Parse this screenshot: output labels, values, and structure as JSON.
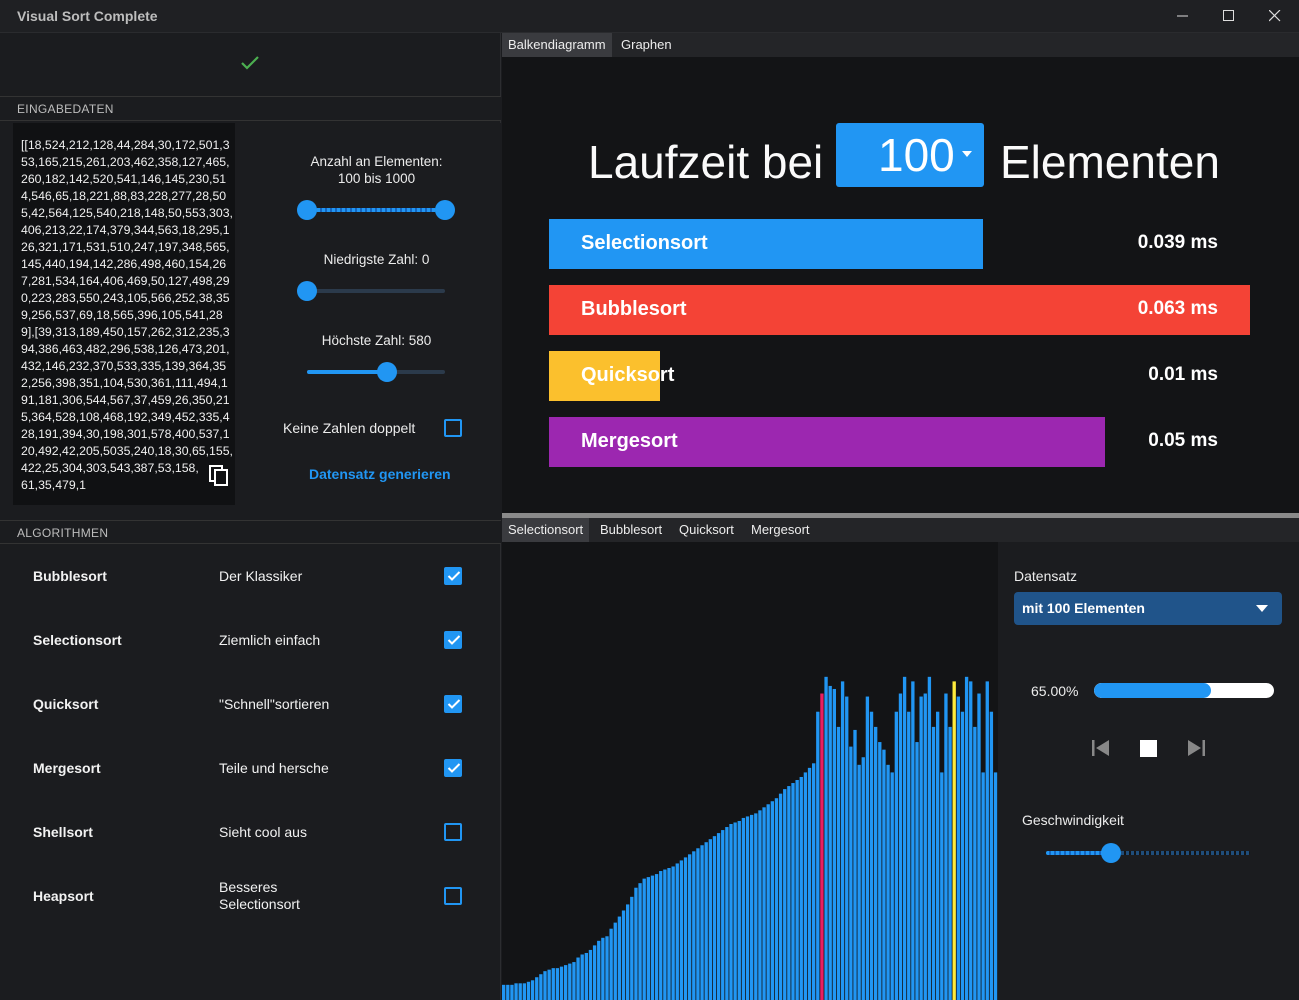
{
  "window": {
    "title": "Visual Sort Complete"
  },
  "sections": {
    "input": "EINGABEDATEN",
    "algorithms": "ALGORITHMEN"
  },
  "input": {
    "text": "[[18,524,212,128,44,284,30,172,501,353,165,215,261,203,462,358,127,465,260,182,142,520,541,146,145,230,514,546,65,18,221,88,83,228,277,28,505,42,564,125,540,218,148,50,553,303,406,213,22,174,379,344,563,18,295,126,321,171,531,510,247,197,348,565,145,440,194,142,286,498,460,154,267,281,534,164,406,469,50,127,498,290,223,283,550,243,105,566,252,38,359,256,537,69,18,565,396,105,541,289],[39,313,189,450,157,262,312,235,394,386,463,482,296,538,126,473,201,432,146,232,370,533,335,139,364,352,256,398,351,104,530,361,111,494,191,181,306,544,567,37,459,26,350,215,364,528,108,468,192,349,452,335,428,191,394,30,198,301,578,400,537,120,492,42,205,5035,240,18,30,65,155,422,25,304,303,543,387,53,158,181,361,35,479,1"
  },
  "controls": {
    "count_label": "Anzahl an Elementen:",
    "count_range": "100 bis 1000",
    "count_min": 100,
    "count_max": 1000,
    "lowest_label": "Niedrigste Zahl: 0",
    "lowest_value": 0,
    "highest_label": "Höchste Zahl: 580",
    "highest_value": 580,
    "no_duplicates_label": "Keine Zahlen doppelt",
    "no_duplicates_checked": false,
    "generate_label": "Datensatz generieren"
  },
  "algorithms": [
    {
      "name": "Bubblesort",
      "desc": "Der Klassiker",
      "checked": true
    },
    {
      "name": "Selectionsort",
      "desc": "Ziemlich einfach",
      "checked": true
    },
    {
      "name": "Quicksort",
      "desc": "\"Schnell\"sortieren",
      "checked": true
    },
    {
      "name": "Mergesort",
      "desc": "Teile und hersche",
      "checked": true
    },
    {
      "name": "Shellsort",
      "desc": "Sieht cool aus",
      "checked": false
    },
    {
      "name": "Heapsort",
      "desc": "Besseres Selectionsort",
      "checked": false
    }
  ],
  "top_tabs": [
    "Balkendiagramm",
    "Graphen"
  ],
  "runtime": {
    "prefix": "Laufzeit bei",
    "selected": "100",
    "suffix": "Elementen"
  },
  "chart_data": {
    "type": "bar",
    "categories": [
      "Selectionsort",
      "Bubblesort",
      "Quicksort",
      "Mergesort"
    ],
    "values": [
      0.039,
      0.063,
      0.01,
      0.05
    ],
    "labels": [
      "0.039 ms",
      "0.063 ms",
      "0.01 ms",
      "0.05 ms"
    ],
    "colors": [
      "#2196f3",
      "#f44336",
      "#fbc02d",
      "#9c27b0"
    ],
    "xmax": 0.063
  },
  "bottom_tabs": [
    "Selectionsort",
    "Bubblesort",
    "Quicksort",
    "Mergesort"
  ],
  "visualizer": {
    "bar_color": "#2196f3",
    "marker_red": "#e91e63",
    "marker_yellow": "#ffeb3b",
    "max_value": 580,
    "values": [
      20,
      20,
      20,
      22,
      22,
      22,
      24,
      26,
      30,
      34,
      38,
      40,
      42,
      42,
      44,
      46,
      48,
      50,
      56,
      60,
      62,
      66,
      72,
      78,
      82,
      84,
      94,
      102,
      110,
      118,
      126,
      136,
      148,
      154,
      160,
      162,
      164,
      166,
      170,
      172,
      174,
      176,
      180,
      184,
      188,
      192,
      196,
      200,
      204,
      208,
      212,
      216,
      220,
      224,
      228,
      232,
      234,
      236,
      240,
      242,
      244,
      246,
      250,
      254,
      258,
      262,
      266,
      272,
      278,
      282,
      286,
      290,
      294,
      300,
      306,
      312,
      380,
      404,
      426,
      414,
      410,
      360,
      420,
      400,
      334,
      356,
      310,
      320,
      400,
      380,
      360,
      340,
      330,
      310,
      300,
      380,
      404,
      426,
      380,
      420,
      340,
      400,
      404,
      426,
      360,
      380,
      300,
      404,
      360,
      420,
      400,
      380,
      426,
      420,
      360,
      404,
      300,
      420,
      380,
      300
    ],
    "red_index": 77,
    "yellow_index": 109,
    "values_note": ""
  },
  "side": {
    "dataset_label": "Datensatz",
    "dataset_value": "mit 100 Elementen",
    "progress_text": "65.00%",
    "progress": 0.65,
    "speed_label": "Geschwindigkeit",
    "speed": 0.3
  }
}
